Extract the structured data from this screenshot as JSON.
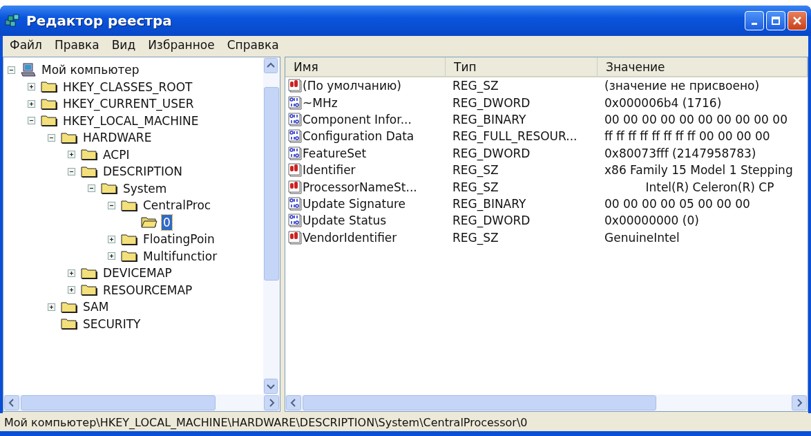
{
  "window": {
    "title": "Редактор реестра"
  },
  "menu": [
    "Файл",
    "Правка",
    "Вид",
    "Избранное",
    "Справка"
  ],
  "tree": [
    {
      "label": "Мой компьютер",
      "kind": "computer",
      "expanded": true,
      "selected": false,
      "children": [
        {
          "label": "HKEY_CLASSES_ROOT",
          "kind": "folder",
          "expanded": false,
          "selected": false
        },
        {
          "label": "HKEY_CURRENT_USER",
          "kind": "folder",
          "expanded": false,
          "selected": false
        },
        {
          "label": "HKEY_LOCAL_MACHINE",
          "kind": "folder",
          "expanded": true,
          "selected": false,
          "children": [
            {
              "label": "HARDWARE",
              "kind": "folder",
              "expanded": true,
              "selected": false,
              "children": [
                {
                  "label": "ACPI",
                  "kind": "folder",
                  "expanded": false,
                  "selected": false
                },
                {
                  "label": "DESCRIPTION",
                  "kind": "folder",
                  "expanded": true,
                  "selected": false,
                  "children": [
                    {
                      "label": "System",
                      "kind": "folder",
                      "expanded": true,
                      "selected": false,
                      "children": [
                        {
                          "label": "CentralProc",
                          "kind": "folder",
                          "expanded": true,
                          "selected": false,
                          "children": [
                            {
                              "label": "0",
                              "kind": "folder",
                              "selected": true
                            }
                          ]
                        },
                        {
                          "label": "FloatingPoin",
                          "kind": "folder",
                          "expanded": false,
                          "selected": false
                        },
                        {
                          "label": "Multifunctior",
                          "kind": "folder",
                          "expanded": false,
                          "selected": false
                        }
                      ]
                    }
                  ]
                },
                {
                  "label": "DEVICEMAP",
                  "kind": "folder",
                  "expanded": false,
                  "selected": false
                },
                {
                  "label": "RESOURCEMAP",
                  "kind": "folder",
                  "expanded": false,
                  "selected": false
                }
              ]
            },
            {
              "label": "SAM",
              "kind": "folder",
              "expanded": false,
              "selected": false
            },
            {
              "label": "SECURITY",
              "kind": "folder",
              "selected": false
            }
          ]
        }
      ]
    }
  ],
  "table": {
    "columns": [
      "Имя",
      "Тип",
      "Значение"
    ],
    "rows": [
      {
        "kind": "string",
        "name": "(По умолчанию)",
        "type": "REG_SZ",
        "value": "(значение не присвоено)"
      },
      {
        "kind": "binary",
        "name": "~MHz",
        "type": "REG_DWORD",
        "value": "0x000006b4 (1716)"
      },
      {
        "kind": "binary",
        "name": "Component Infor...",
        "type": "REG_BINARY",
        "value": "00 00 00 00 00 00 00 00 00 00"
      },
      {
        "kind": "binary",
        "name": "Configuration Data",
        "type": "REG_FULL_RESOUR...",
        "value": "ff ff ff ff ff ff ff ff 00 00 00 00"
      },
      {
        "kind": "binary",
        "name": "FeatureSet",
        "type": "REG_DWORD",
        "value": "0x80073fff (2147958783)"
      },
      {
        "kind": "string",
        "name": "Identifier",
        "type": "REG_SZ",
        "value": "x86 Family 15 Model 1 Stepping"
      },
      {
        "kind": "string",
        "name": "ProcessorNameSt...",
        "type": "REG_SZ",
        "value": "           Intel(R) Celeron(R) CP"
      },
      {
        "kind": "binary",
        "name": "Update Signature",
        "type": "REG_BINARY",
        "value": "00 00 00 00 05 00 00 00"
      },
      {
        "kind": "binary",
        "name": "Update Status",
        "type": "REG_DWORD",
        "value": "0x00000000 (0)"
      },
      {
        "kind": "string",
        "name": "VendorIdentifier",
        "type": "REG_SZ",
        "value": "GenuineIntel"
      }
    ]
  },
  "status_bar": "Мой компьютер\\HKEY_LOCAL_MACHINE\\HARDWARE\\DESCRIPTION\\System\\CentralProcessor\\0"
}
